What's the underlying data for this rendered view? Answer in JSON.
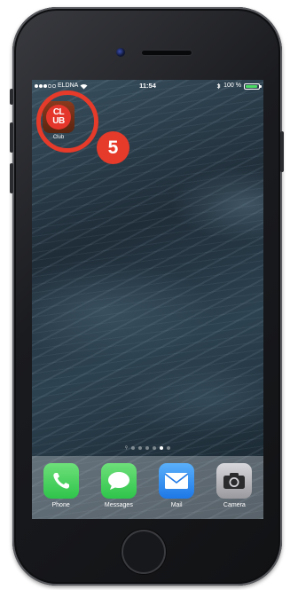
{
  "status_bar": {
    "carrier": "ELDNA",
    "time": "11:54",
    "battery_percent": "100 %"
  },
  "home_screen": {
    "club_app": {
      "icon_text_line1": "CL",
      "icon_text_line2": "UB",
      "caption": "Club"
    },
    "step_number": "5",
    "page_count": 6,
    "active_page": 5
  },
  "dock": {
    "items": [
      {
        "label": "Phone",
        "icon": "phone-icon",
        "color": "#4cd964"
      },
      {
        "label": "Messages",
        "icon": "messages-icon",
        "color": "#4cd964"
      },
      {
        "label": "Mail",
        "icon": "mail-icon",
        "color": "#2a8cf0"
      },
      {
        "label": "Camera",
        "icon": "camera-icon",
        "color": "#9a9a9e"
      }
    ]
  },
  "colors": {
    "highlight": "#e63a2a",
    "battery_fill": "#4cd964"
  }
}
